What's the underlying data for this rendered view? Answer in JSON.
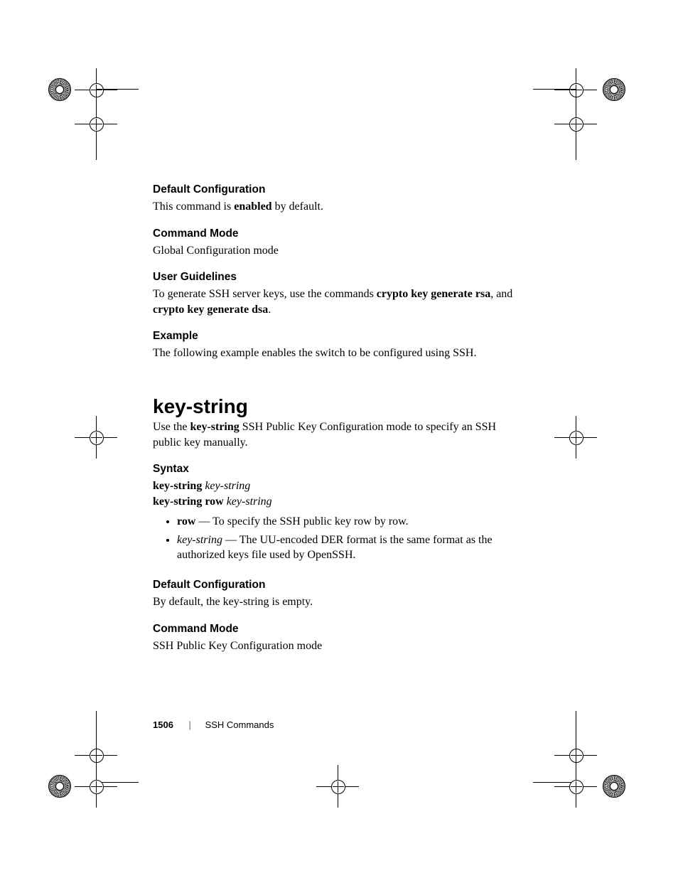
{
  "sections": {
    "defconfig1": {
      "head": "Default Configuration",
      "text_pre": "This command is ",
      "text_bold": "enabled",
      "text_post": " by default."
    },
    "cmdmode1": {
      "head": "Command Mode",
      "text": "Global Configuration mode"
    },
    "userguide": {
      "head": "User Guidelines",
      "text_pre": "To generate SSH server keys, use the commands ",
      "b1": "crypto key generate rsa",
      "mid": ", and ",
      "b2": "crypto key generate dsa",
      "post": "."
    },
    "example": {
      "head": "Example",
      "text": "The following example enables the switch to be configured using SSH."
    }
  },
  "command": {
    "name": "key-string",
    "desc_pre": "Use the ",
    "desc_bold": "key-string",
    "desc_post": " SSH Public Key Configuration mode to specify an SSH public key manually."
  },
  "syntax": {
    "head": "Syntax",
    "line1_bold": "key-string",
    "line1_ital": "key-string",
    "line2_bold": "key-string row",
    "line2_ital": "key-string",
    "bullets": [
      {
        "bold": "row",
        "sep": " — ",
        "rest": "To specify the SSH public key row by row."
      },
      {
        "ital": "key-string",
        "sep": " — ",
        "rest": "The UU-encoded DER format is the same format as the authorized keys file used by OpenSSH."
      }
    ]
  },
  "defconfig2": {
    "head": "Default Configuration",
    "text": "By default, the key-string is empty."
  },
  "cmdmode2": {
    "head": "Command Mode",
    "text": "SSH Public Key Configuration mode"
  },
  "footer": {
    "page": "1506",
    "chapter": "SSH Commands"
  }
}
